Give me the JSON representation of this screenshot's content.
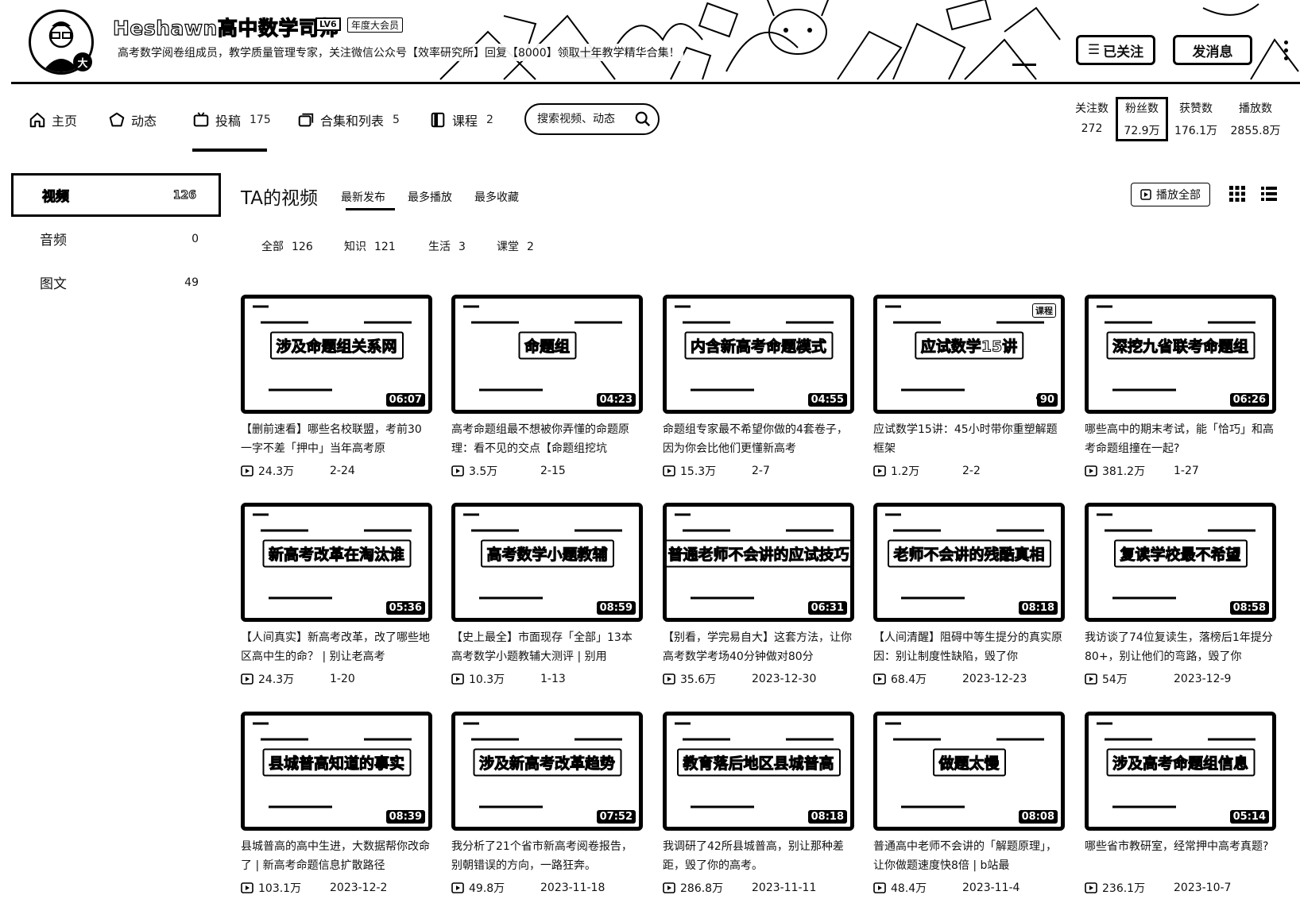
{
  "header": {
    "username": "Heshawn高中数学司师",
    "level": "LV6",
    "vip": "年度大会员",
    "avatar_badge": "大",
    "sign": "高考数学阅卷组成员，教学质量管理专家，关注微信公众号【效率研究所】回复【8000】领取十年教学精华合集！",
    "follow_button": "已关注",
    "message_button": "发消息"
  },
  "nav": {
    "tabs": [
      {
        "label": "主页",
        "count": "",
        "icon": "home-icon"
      },
      {
        "label": "动态",
        "count": "",
        "icon": "activity-icon"
      },
      {
        "label": "投稿",
        "count": "175",
        "icon": "video-icon"
      },
      {
        "label": "合集和列表",
        "count": "5",
        "icon": "collection-icon"
      },
      {
        "label": "课程",
        "count": "2",
        "icon": "course-icon"
      }
    ],
    "search_placeholder": "搜索视频、动态"
  },
  "stats": [
    {
      "label": "关注数",
      "value": "272"
    },
    {
      "label": "粉丝数",
      "value": "72.9万"
    },
    {
      "label": "获赞数",
      "value": "176.1万"
    },
    {
      "label": "播放数",
      "value": "2855.8万"
    }
  ],
  "sidebar": {
    "items": [
      {
        "label": "视频",
        "count": "126"
      },
      {
        "label": "音频",
        "count": "0"
      },
      {
        "label": "图文",
        "count": "49"
      }
    ]
  },
  "main": {
    "title": "TA的视频",
    "sort_tabs": [
      "最新发布",
      "最多播放",
      "最多收藏"
    ],
    "play_all": "播放全部",
    "filters": [
      {
        "label": "全部",
        "count": "126"
      },
      {
        "label": "知识",
        "count": "121"
      },
      {
        "label": "生活",
        "count": "3"
      },
      {
        "label": "课堂",
        "count": "2"
      }
    ]
  },
  "videos": [
    {
      "thumb_text": "涉及命题组关系网",
      "duration": "06:07",
      "title": "【删前速看】哪些名校联盟，考前30一字不差「押中」当年高考原",
      "plays": "24.3万",
      "date": "2-24"
    },
    {
      "thumb_text": "命题组",
      "duration": "04:23",
      "title": "高考命题组最不想被你弄懂的命题原理：看不见的交点【命题组挖坑",
      "plays": "3.5万",
      "date": "2-15"
    },
    {
      "thumb_text": "内含新高考命题模式",
      "duration": "04:55",
      "title": "命题组专家最不希望你做的4套卷子，因为你会比他们更懂新高考",
      "plays": "15.3万",
      "date": "2-7"
    },
    {
      "thumb_text": "应试数学15讲",
      "duration": "90",
      "title": "应试数学15讲：45小时带你重塑解题框架",
      "plays": "1.2万",
      "date": "2-2",
      "badge": "课程"
    },
    {
      "thumb_text": "深挖九省联考命题组",
      "duration": "06:26",
      "title": "哪些高中的期末考试，能「恰巧」和高考命题组撞在一起?",
      "plays": "381.2万",
      "date": "1-27"
    },
    {
      "thumb_text": "新高考改革在淘汰谁",
      "duration": "05:36",
      "title": "【人间真实】新高考改革，改了哪些地区高中生的命？ | 别让老高考",
      "plays": "24.3万",
      "date": "1-20"
    },
    {
      "thumb_text": "高考数学小题教辅",
      "duration": "08:59",
      "title": "【史上最全】市面现存「全部」13本高考数学小题教辅大测评 | 别用",
      "plays": "10.3万",
      "date": "1-13"
    },
    {
      "thumb_text": "普通老师不会讲的应试技巧",
      "duration": "06:31",
      "title": "【别看，学完易自大】这套方法，让你高考数学考场40分钟做对80分",
      "plays": "35.6万",
      "date": "2023-12-30"
    },
    {
      "thumb_text": "老师不会讲的残酷真相",
      "duration": "08:18",
      "title": "【人间清醒】阻碍中等生提分的真实原因：别让制度性缺陷，毁了你",
      "plays": "68.4万",
      "date": "2023-12-23"
    },
    {
      "thumb_text": "复读学校最不希望",
      "duration": "08:58",
      "title": "我访谈了74位复读生，落榜后1年提分80+，别让他们的弯路，毁了你",
      "plays": "54万",
      "date": "2023-12-9"
    },
    {
      "thumb_text": "县城普高知道的事实",
      "duration": "08:39",
      "title": "县城普高的高中生进，大数据帮你改命了 | 新高考命题信息扩散路径",
      "plays": "103.1万",
      "date": "2023-12-2"
    },
    {
      "thumb_text": "涉及新高考改革趋势",
      "duration": "07:52",
      "title": "我分析了21个省市新高考阅卷报告，别朝错误的方向，一路狂奔。",
      "plays": "49.8万",
      "date": "2023-11-18"
    },
    {
      "thumb_text": "教育落后地区县城普高",
      "duration": "08:18",
      "title": "我调研了42所县城普高，别让那种差距，毁了你的高考。",
      "plays": "286.8万",
      "date": "2023-11-11"
    },
    {
      "thumb_text": "做题太慢",
      "duration": "08:08",
      "title": "普通高中老师不会讲的「解题原理」，让你做题速度快8倍 | b站最",
      "plays": "48.4万",
      "date": "2023-11-4"
    },
    {
      "thumb_text": "涉及高考命题组信息",
      "duration": "05:14",
      "title": "哪些省市教研室，经常押中高考真题?",
      "plays": "236.1万",
      "date": "2023-10-7"
    }
  ]
}
